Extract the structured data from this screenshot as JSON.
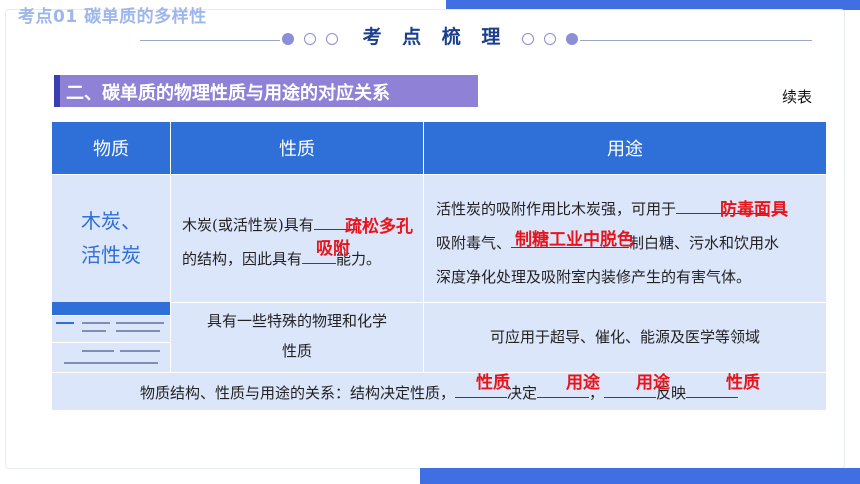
{
  "header": {
    "topic": "考点01  碳单质的多样性",
    "section_title": "考 点 梳 理"
  },
  "subtitle": "二、碳单质的物理性质与用途的对应关系",
  "continued_label": "续表",
  "table": {
    "columns": [
      "物质",
      "性质",
      "用途"
    ],
    "row1": {
      "substance_line1": "木炭、",
      "substance_line2": "活性炭",
      "property_part1": "木炭(或活性炭)具有",
      "property_part2": "的结构，因此具有",
      "property_part3": "能力。",
      "property_answer1": "疏松多孔",
      "property_answer2": "吸附",
      "use_part1": "活性炭的吸附作用比木炭强，可用于",
      "use_part2": "吸附毒气、",
      "use_part3": "制白糖、污水和饮用水",
      "use_part4": "深度净化处理及吸附室内装修产生的有害气体。",
      "use_answer1": "防毒面具",
      "use_answer2": "制糖工业中脱色"
    },
    "row2": {
      "property_line1": "具有一些特殊的物理和化学",
      "property_line2": "性质",
      "use": "可应用于超导、催化、能源及医学等领域"
    },
    "footer": {
      "part1": "物质结构、性质与用途的关系：结构决定性质，",
      "part2": "决定",
      "part3": "，",
      "part4": "反映",
      "answers": [
        "性质",
        "用途",
        "用途",
        "性质"
      ]
    }
  },
  "colors": {
    "accent_blue": "#2e6fd8",
    "answer_red": "#e8141b",
    "subtitle_purple": "#8f81d6"
  }
}
